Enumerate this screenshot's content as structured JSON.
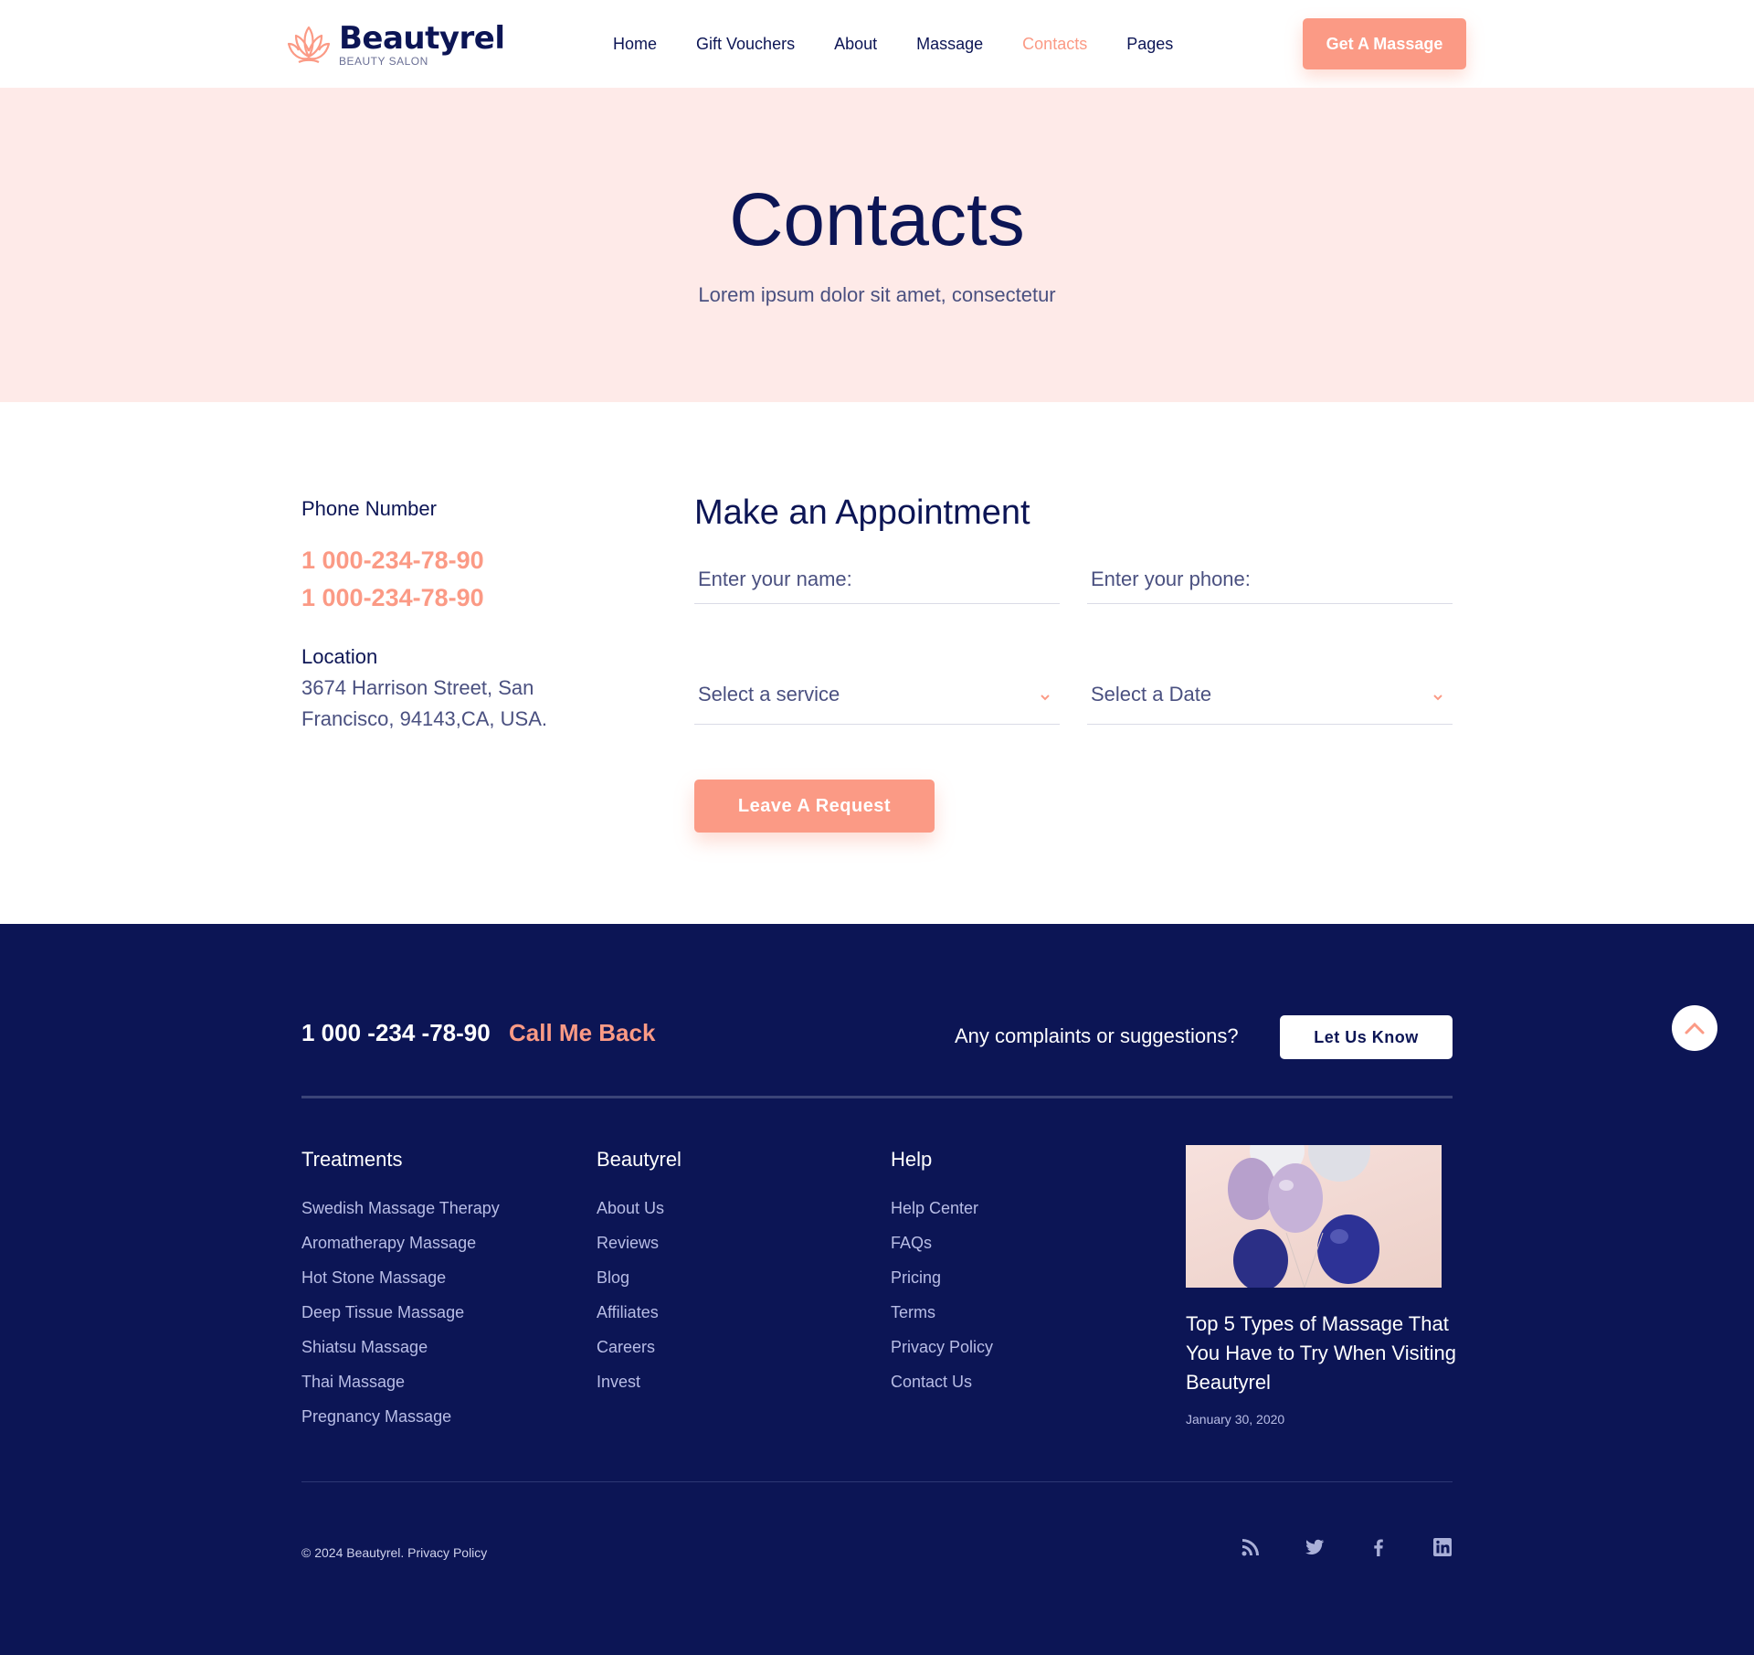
{
  "brand": {
    "name": "Beautyrel",
    "tagline": "BEAUTY SALON",
    "accent_color": "#fb9a85",
    "navy_color": "#0c1555"
  },
  "nav": {
    "items": [
      {
        "label": "Home",
        "active": false
      },
      {
        "label": "Gift Vouchers",
        "active": false
      },
      {
        "label": "About",
        "active": false
      },
      {
        "label": "Massage",
        "active": false
      },
      {
        "label": "Contacts",
        "active": true
      },
      {
        "label": "Pages",
        "active": false
      }
    ],
    "cta_label": "Get A Massage"
  },
  "hero": {
    "title": "Contacts",
    "subtitle": "Lorem ipsum dolor sit amet, consectetur"
  },
  "contact_info": {
    "phone_label": "Phone Number",
    "phones": [
      "1 000-234-78-90",
      "1 000-234-78-90"
    ],
    "location_label": "Location",
    "address_line1": "3674 Harrison Street, San",
    "address_line2": "Francisco, 94143,CA, USA."
  },
  "appointment_form": {
    "title": "Make an Appointment",
    "name_placeholder": "Enter your name:",
    "phone_placeholder": "Enter your phone:",
    "service_placeholder": "Select a service",
    "date_placeholder": "Select a Date",
    "submit_label": "Leave A Request"
  },
  "footer": {
    "phone": "1 000 -234 -78-90",
    "callback_label": "Call Me Back",
    "complaints_text": "Any complaints or suggestions?",
    "let_us_know_label": "Let Us Know",
    "columns": [
      {
        "title": "Treatments",
        "links": [
          "Swedish Massage Therapy",
          "Aromatherapy Massage",
          "Hot Stone Massage",
          "Deep Tissue Massage",
          "Shiatsu Massage",
          "Thai Massage",
          "Pregnancy Massage"
        ]
      },
      {
        "title": "Beautyrel",
        "links": [
          "About Us",
          "Reviews",
          "Blog",
          "Affiliates",
          "Careers",
          "Invest"
        ]
      },
      {
        "title": "Help",
        "links": [
          "Help Center",
          "FAQs",
          "Pricing",
          "Terms",
          "Privacy Policy",
          "Contact Us"
        ]
      }
    ],
    "blog": {
      "title": "Top 5 Types of Massage That You Have to Try When Visiting Beautyrel",
      "date": "January 30, 2020",
      "image_icon": "balloons-image"
    },
    "copyright": "©  2024 Beautyrel. Privacy Policy",
    "social_icons": [
      "rss-icon",
      "twitter-icon",
      "facebook-icon",
      "linkedin-icon"
    ]
  }
}
